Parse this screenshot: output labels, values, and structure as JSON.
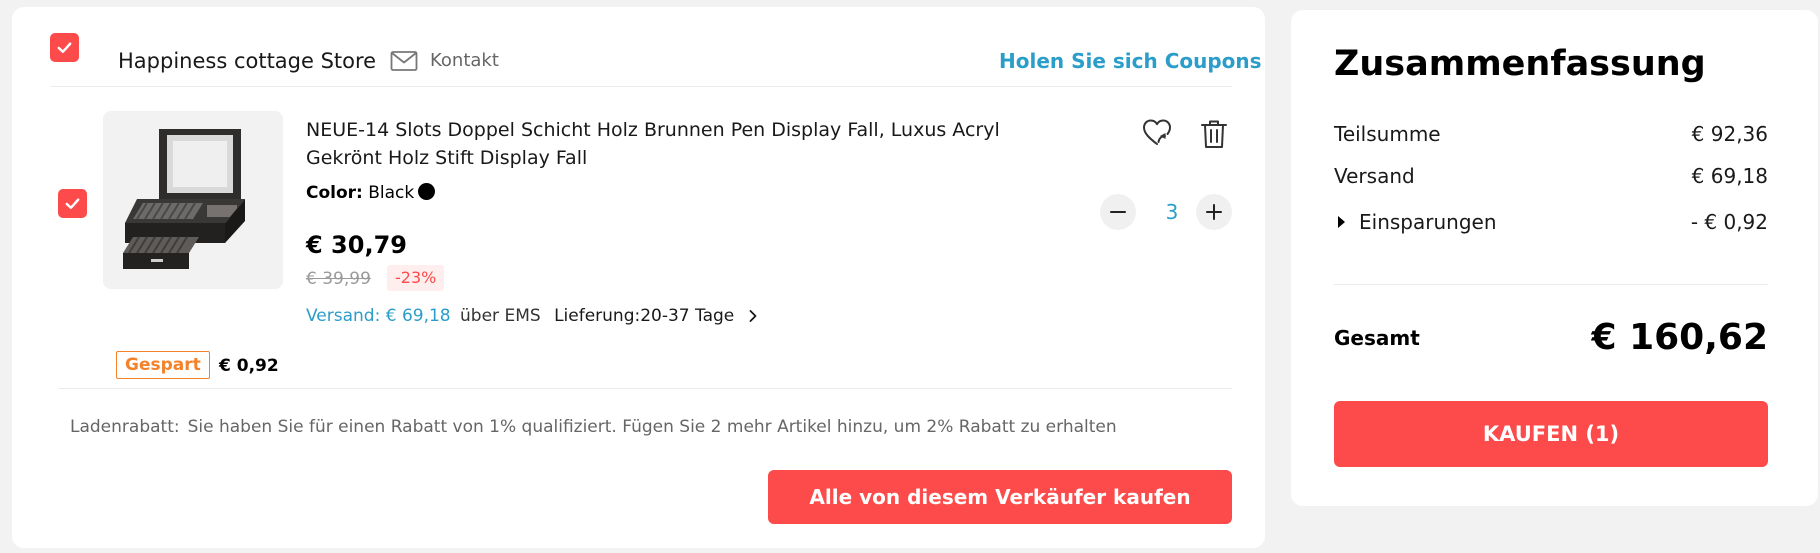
{
  "store": {
    "name": "Happiness cottage Store",
    "contact_label": "Kontakt",
    "coupons_label": "Holen Sie sich Coupons"
  },
  "product": {
    "title": "NEUE-14 Slots Doppel Schicht Holz Brunnen Pen Display Fall, Luxus Acryl Gekrönt Holz Stift Display Fall",
    "color_label": "Color:",
    "color_value": "Black",
    "color_swatch": "#000000",
    "price": "€ 30,79",
    "old_price": "€ 39,99",
    "discount": "-23%",
    "shipping_price": "Versand: € 69,18",
    "shipping_via": "über EMS",
    "delivery": "Lieferung:20-37 Tage",
    "quantity": "3",
    "saved_badge": "Gespart",
    "saved_amount": "€ 0,92"
  },
  "rebate": {
    "label": "Ladenrabatt:",
    "text": "Sie haben Sie für einen Rabatt von 1% qualifiziert. Fügen Sie 2 mehr Artikel hinzu, um 2% Rabatt zu erhalten"
  },
  "buy_seller_label": "Alle von diesem Verkäufer kaufen",
  "summary": {
    "title": "Zusammenfassung",
    "subtotal_label": "Teilsumme",
    "subtotal_value": "€ 92,36",
    "shipping_label": "Versand",
    "shipping_value": "€ 69,18",
    "savings_label": "Einsparungen",
    "savings_value": "- € 0,92",
    "total_label": "Gesamt",
    "total_value": "€ 160,62",
    "buy_label": "KAUFEN (1)"
  },
  "colors": {
    "accent_red": "#fd4a4a",
    "link_blue": "#2b9dc9",
    "saved_orange": "#f4822a"
  },
  "icons": [
    "checkbox-checked-icon",
    "mail-icon",
    "wishlist-heart-icon",
    "trash-icon",
    "minus-icon",
    "plus-icon",
    "chevron-right-icon",
    "triangle-right-icon"
  ]
}
